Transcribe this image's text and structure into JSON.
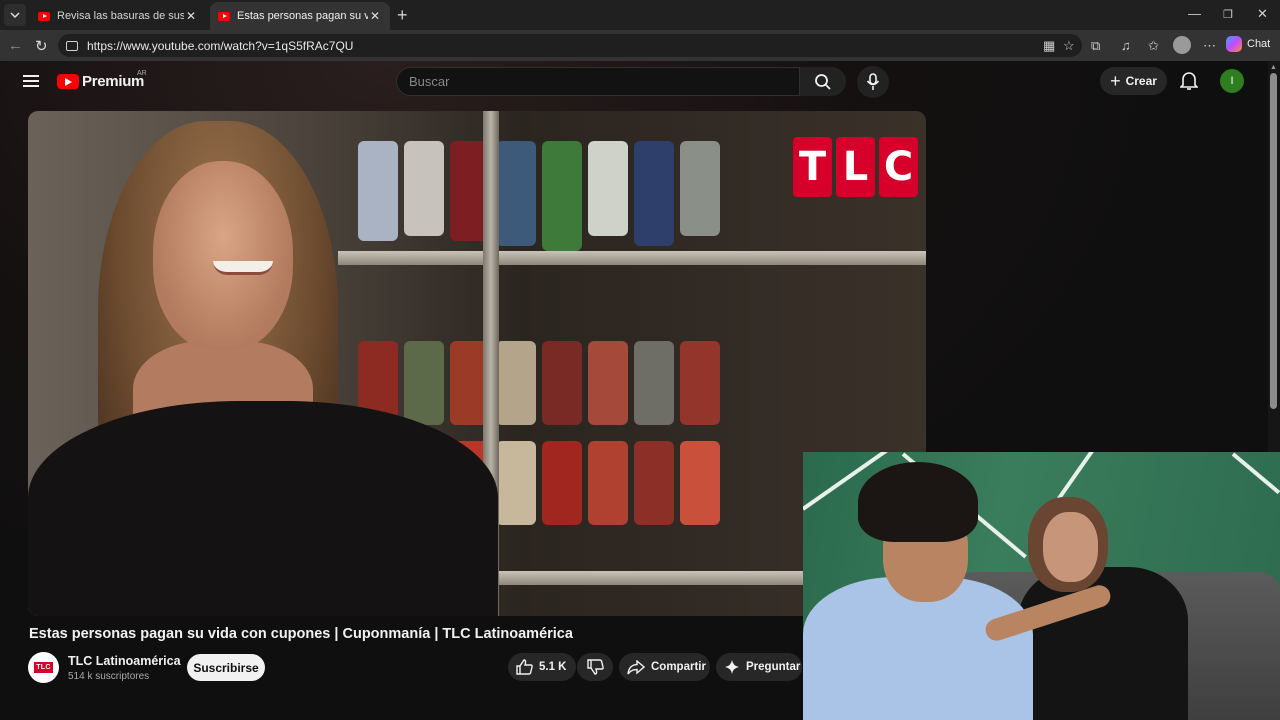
{
  "browser": {
    "tabs": [
      {
        "title": "Revisa las basuras de sus amigos p",
        "active": false
      },
      {
        "title": "Estas personas pagan su vida con c",
        "active": true
      }
    ],
    "url": "https://www.youtube.com/watch?v=1qS5fRAc7QU",
    "chat_label": "Chat",
    "window_controls": {
      "minimize": "—",
      "restore": "❐",
      "close": "✕"
    }
  },
  "youtube": {
    "logo_text": "Premium",
    "country_code": "AR",
    "search_placeholder": "Buscar",
    "create_label": "Crear",
    "avatar_initial": "I",
    "avatar_color": "#2e7d1e",
    "video": {
      "overlay_logo": [
        "T",
        "L",
        "C"
      ],
      "title": "Estas personas pagan su vida con cupones | Cuponmanía | TLC Latinoamérica"
    },
    "channel": {
      "avatar_text": "TLC",
      "name": "TLC Latinoamérica",
      "subscribers": "514 k suscriptores",
      "subscribe_label": "Suscribirse"
    },
    "actions": {
      "like_count": "5.1 K",
      "share_label": "Compartir",
      "ask_label": "Preguntar"
    }
  },
  "icons": [
    "tab-list-icon",
    "youtube-favicon",
    "close-icon",
    "plus-icon",
    "back-icon",
    "reload-icon",
    "site-info-icon",
    "split-screen-icon",
    "star-icon",
    "extensions-icon",
    "collections-icon",
    "favorites-icon",
    "profile-icon",
    "more-icon",
    "copilot-icon",
    "hamburger-icon",
    "search-icon",
    "mic-icon",
    "bell-icon",
    "like-icon",
    "dislike-icon",
    "share-icon",
    "sparkle-icon"
  ],
  "colors": {
    "brand_red": "#ff0000",
    "tlc_red": "#d6002a",
    "background": "#0f0f0f"
  }
}
